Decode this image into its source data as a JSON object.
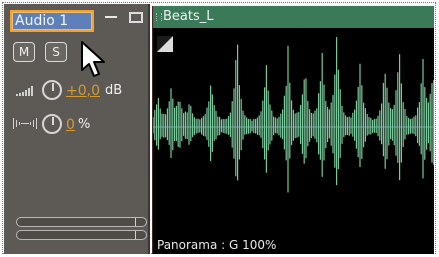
{
  "track": {
    "name": "Audio 1",
    "mute_label": "M",
    "solo_label": "S",
    "volume_value": "+0,0",
    "volume_unit": "dB",
    "pan_value": "0",
    "pan_unit": "%"
  },
  "clip": {
    "title": "Beats_L",
    "panorama_text": "Panorama : G 100%"
  },
  "colors": {
    "track_name_bg": "#5e7fb7",
    "track_name_border": "#f2a22d",
    "value_orange": "#d69a2f",
    "clip_header_bg": "#3b7a58",
    "waveform_green": "#79c99a",
    "center_line": "#6d79c7",
    "panel_bg": "#5d5a55"
  },
  "icons": {
    "volume": "volume-bars-icon",
    "pan": "stereo-pan-icon",
    "knob": "knob-icon",
    "cursor": "mouse-pointer-icon",
    "minimize": "minimize-icon",
    "maximize": "maximize-icon",
    "fade": "fade-handle-icon"
  }
}
